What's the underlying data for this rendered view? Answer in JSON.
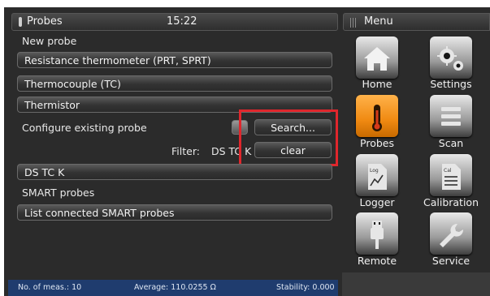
{
  "header": {
    "title": "Probes",
    "time": "15:22"
  },
  "new_probe": {
    "label": "New probe",
    "options": [
      "Resistance thermometer (PRT, SPRT)",
      "Thermocouple (TC)",
      "Thermistor"
    ]
  },
  "configure": {
    "label": "Configure existing probe",
    "search_label": "Search...",
    "filter_label": "Filter:",
    "filter_value": "DS TC K",
    "clear_label": "clear",
    "result": "DS TC K"
  },
  "smart": {
    "label": "SMART probes",
    "list_button": "List connected SMART probes"
  },
  "status": {
    "meas": "No. of meas.: 10",
    "average": "Average: 110.0255 Ω",
    "stability": "Stability: 0.000"
  },
  "menu": {
    "title": "Menu",
    "items": [
      {
        "label": "Home",
        "icon": "home-icon"
      },
      {
        "label": "Settings",
        "icon": "gears-icon"
      },
      {
        "label": "Probes",
        "icon": "thermometer-icon",
        "active": true
      },
      {
        "label": "Scan",
        "icon": "list-icon"
      },
      {
        "label": "Logger",
        "icon": "log-icon"
      },
      {
        "label": "Calibration",
        "icon": "cal-icon"
      },
      {
        "label": "Remote",
        "icon": "usb-plug-icon"
      },
      {
        "label": "Service",
        "icon": "wrench-icon"
      }
    ]
  },
  "colors": {
    "accent": "#f08a12",
    "highlight": "#e0262c",
    "statusbar": "#1f3c6e"
  }
}
